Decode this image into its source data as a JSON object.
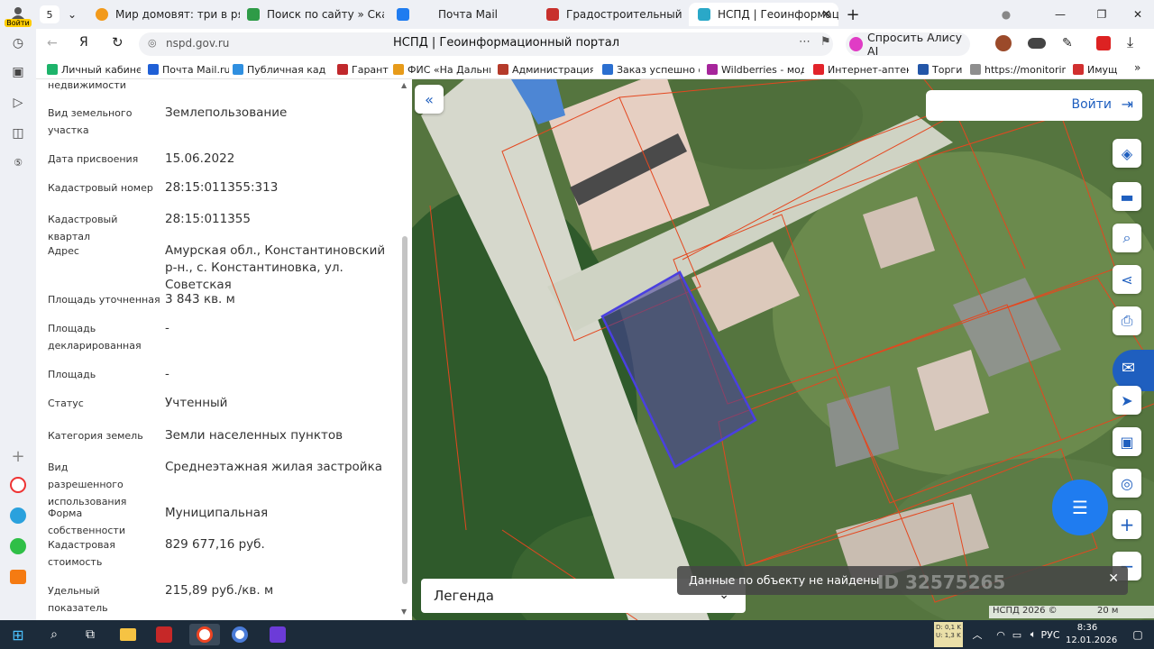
{
  "browser": {
    "tab_count": "5",
    "tabs": [
      {
        "title": "Мир домовят: три в ряд",
        "color": "#f29a1b"
      },
      {
        "title": "Поиск по сайту » Скачать",
        "color": "#2e9b47"
      },
      {
        "title": "Почта Mail",
        "color": "#1f7cf0"
      },
      {
        "title": "Градостроительный план",
        "color": "#c8302c"
      },
      {
        "title": "НСПД | Геоинформаци",
        "color": "#2aa8c8"
      }
    ],
    "url": "nspd.gov.ru",
    "page_title": "НСПД | Геоинформационный портал",
    "ask_alice": "Спросить Алису AI",
    "profile_label": "Войти",
    "bookmarks": [
      {
        "label": "Личный кабинет",
        "color": "#1db36a"
      },
      {
        "label": "Почта Mail.ru",
        "color": "#1f5fd6"
      },
      {
        "label": "Публичная кадас",
        "color": "#2f8fe0"
      },
      {
        "label": "Гарант",
        "color": "#c0282c"
      },
      {
        "label": "ФИС «На Дальни",
        "color": "#e79b1a"
      },
      {
        "label": "Администрация К",
        "color": "#b53a2a"
      },
      {
        "label": "Заказ успешно оф",
        "color": "#2b6fd0"
      },
      {
        "label": "Wildberries - моде",
        "color": "#a6259b"
      },
      {
        "label": "Интернет-аптека",
        "color": "#e2232a"
      },
      {
        "label": "Торги",
        "color": "#2356a8"
      },
      {
        "label": "https://monitoring",
        "color": "#8e8e8e"
      },
      {
        "label": "Имущ",
        "color": "#d12f2f"
      }
    ]
  },
  "parcel": {
    "top_fragment": "недвижимости",
    "fields": [
      {
        "label": "Вид земельного участка",
        "value": "Землепользование"
      },
      {
        "label": "Дата присвоения",
        "value": "15.06.2022"
      },
      {
        "label": "Кадастровый номер",
        "value": "28:15:011355:313"
      },
      {
        "label": "Кадастровый квартал",
        "value": "28:15:011355"
      },
      {
        "label": "Адрес",
        "value": "Амурская обл., Константиновский р-н., с. Константиновка, ул. Советская"
      },
      {
        "label": "Площадь уточненная",
        "value": "3 843 кв. м"
      },
      {
        "label": "Площадь декларированная",
        "value": "-"
      },
      {
        "label": "Площадь",
        "value": "-"
      },
      {
        "label": "Статус",
        "value": "Учтенный"
      },
      {
        "label": "Категория земель",
        "value": "Земли населенных пунктов"
      },
      {
        "label": "Вид разрешенного использования",
        "value": "Среднеэтажная жилая застройка"
      },
      {
        "label": "Форма собственности",
        "value": "Муниципальная"
      },
      {
        "label": "Кадастровая стоимость",
        "value": "829 677,16 руб."
      },
      {
        "label": "Удельный показатель кадастровой",
        "value": "215,89 руб./кв. м"
      }
    ]
  },
  "map": {
    "login": "Войти",
    "legend": "Легенда",
    "toast": "Данные по объекту не найдены",
    "watermark": "ID 32575265",
    "copyright": "НСПД 2026 ©",
    "scale": "20 м",
    "plus": "+",
    "minus": "−"
  },
  "taskbar": {
    "time": "8:36",
    "date": "12.01.2026",
    "lang": "РУС",
    "net_down": "D: 0,1 K",
    "net_up": "U: 1,3 K"
  }
}
